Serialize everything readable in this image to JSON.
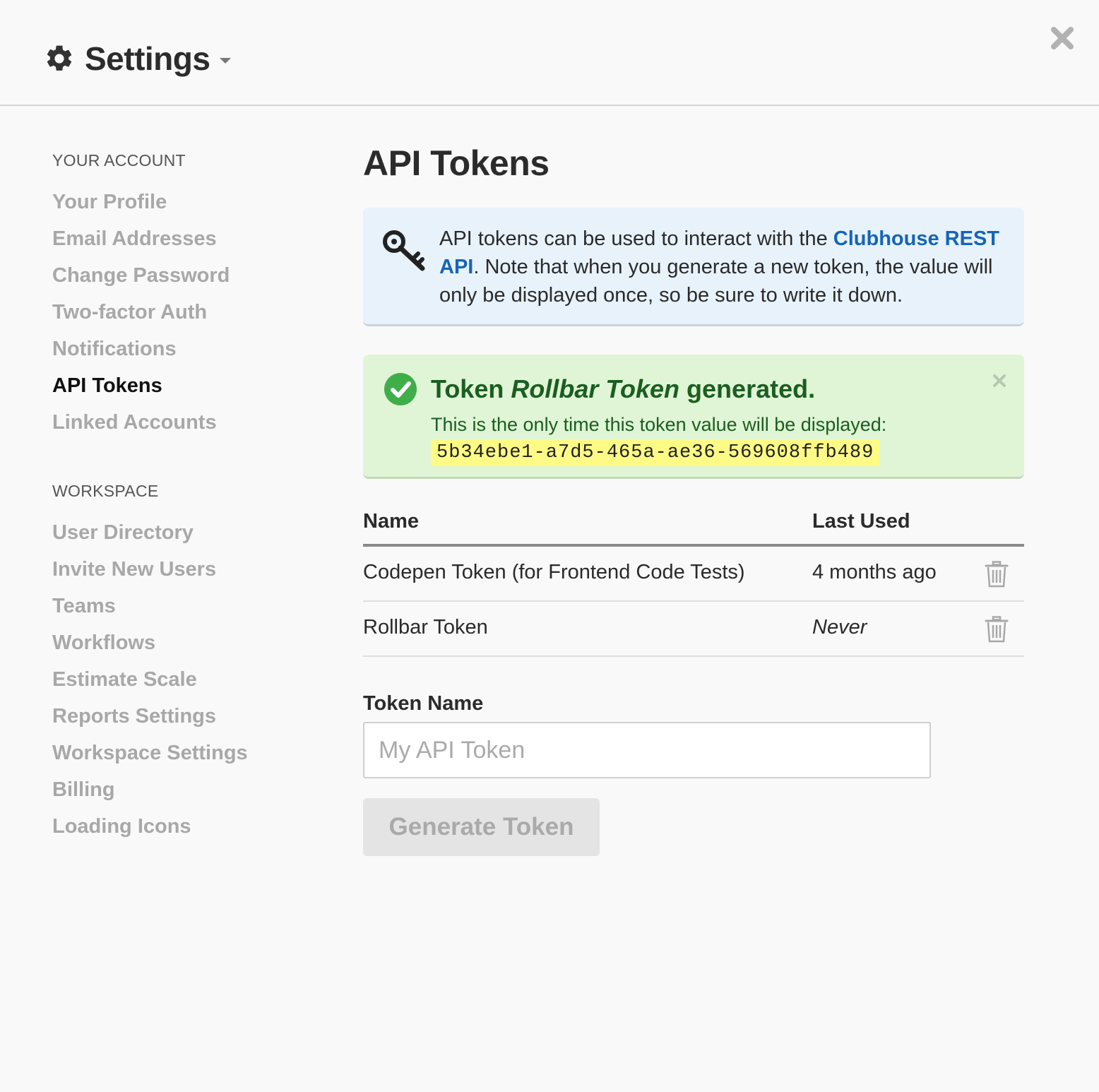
{
  "header": {
    "title": "Settings"
  },
  "sidebar": {
    "account_heading": "YOUR ACCOUNT",
    "account_items": [
      {
        "label": "Your Profile"
      },
      {
        "label": "Email Addresses"
      },
      {
        "label": "Change Password"
      },
      {
        "label": "Two-factor Auth"
      },
      {
        "label": "Notifications"
      },
      {
        "label": "API Tokens",
        "active": true
      },
      {
        "label": "Linked Accounts"
      }
    ],
    "workspace_heading": "WORKSPACE",
    "workspace_items": [
      {
        "label": "User Directory"
      },
      {
        "label": "Invite New Users"
      },
      {
        "label": "Teams"
      },
      {
        "label": "Workflows"
      },
      {
        "label": "Estimate Scale"
      },
      {
        "label": "Reports Settings"
      },
      {
        "label": "Workspace Settings"
      },
      {
        "label": "Billing"
      },
      {
        "label": "Loading Icons"
      }
    ]
  },
  "main": {
    "title": "API Tokens",
    "info": {
      "text_before": "API tokens can be used to interact with the ",
      "link_text": "Clubhouse REST API",
      "text_after": ". Note that when you generate a new token, the value will only be displayed once, so be sure to write it down."
    },
    "success": {
      "title_prefix": "Token ",
      "token_name": "Rollbar Token",
      "title_suffix": " generated.",
      "subtitle": "This is the only time this token value will be displayed:",
      "token_value": "5b34ebe1-a7d5-465a-ae36-569608ffb489"
    },
    "table": {
      "columns": {
        "name": "Name",
        "last_used": "Last Used"
      },
      "rows": [
        {
          "name": "Codepen Token (for Frontend Code Tests)",
          "last_used": "4 months ago"
        },
        {
          "name": "Rollbar Token",
          "last_used": "Never"
        }
      ]
    },
    "form": {
      "label": "Token Name",
      "placeholder": "My API Token",
      "value": "",
      "button_label": "Generate Token"
    }
  },
  "colors": {
    "link": "#1565b7",
    "info_bg": "#e8f2fb",
    "success_bg": "#dff5d6",
    "success_text": "#1b5e20",
    "success_icon": "#3fae49",
    "token_highlight": "#fdfb86"
  },
  "icons": [
    "gear-icon",
    "chevron-down-icon",
    "close-icon",
    "key-icon",
    "check-circle-icon",
    "dismiss-icon",
    "trash-icon"
  ]
}
